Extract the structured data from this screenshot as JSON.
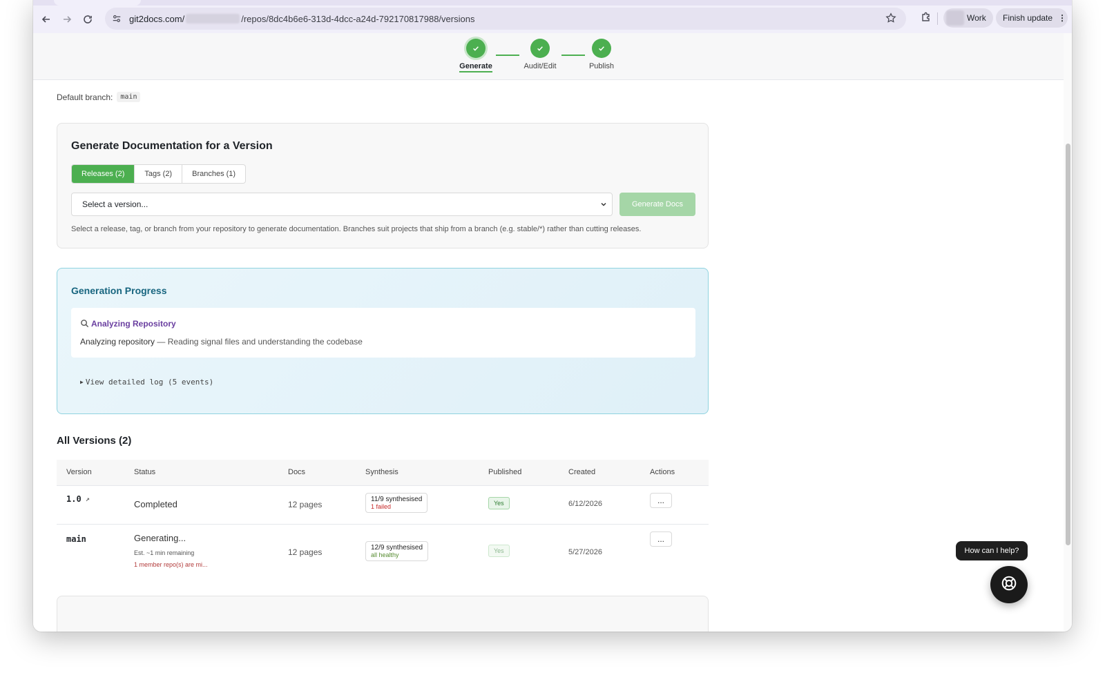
{
  "browser": {
    "url_host": "git2docs.com/",
    "url_path": "/repos/8dc4b6e6-313d-4dcc-a24d-792170817988/versions",
    "profile_label": "Work",
    "update_label": "Finish update",
    "icons": [
      "back-icon",
      "forward-icon",
      "reload-icon",
      "site-settings-icon",
      "star-icon",
      "extensions-icon",
      "more-vert-icon"
    ]
  },
  "stepper": {
    "steps": [
      {
        "label": "Generate",
        "active": true
      },
      {
        "label": "Audit/Edit",
        "active": false
      },
      {
        "label": "Publish",
        "active": false
      }
    ],
    "accent": "#4caf50"
  },
  "repo": {
    "default_branch_label": "Default branch:",
    "default_branch": "main"
  },
  "generate": {
    "title": "Generate Documentation for a Version",
    "tabs": [
      "Releases (2)",
      "Tags (2)",
      "Branches (1)"
    ],
    "active_tab": 0,
    "select_value": "Select a version...",
    "button": "Generate Docs",
    "help": "Select a release, tag, or branch from your repository to generate documentation. Branches suit projects that ship from a branch (e.g. stable/*) rather than cutting releases."
  },
  "progress": {
    "title": "Generation Progress",
    "stage": "Analyzing Repository",
    "desc_strong": "Analyzing repository",
    "desc_rest": " — Reading signal files and understanding the codebase",
    "log_toggle": "View detailed log (5 events)"
  },
  "versions": {
    "title": "All Versions (2)",
    "columns": [
      "Version",
      "Status",
      "Docs",
      "Synthesis",
      "Published",
      "Created",
      "Actions"
    ],
    "rows": [
      {
        "version": "1.0",
        "status": "Completed",
        "docs": "12 pages",
        "synthesis": "11/9 synthesised",
        "synthesis_sub": "1 failed",
        "published": "Yes",
        "created": "6/12/2026",
        "actions": "..."
      },
      {
        "version": "main",
        "status": "Generating...",
        "status_sub": "Est. ~1 min remaining",
        "status_warn": "1 member repo(s) are mi...",
        "docs": "12 pages",
        "synthesis": "12/9 synthesised",
        "synthesis_sub": "all healthy",
        "published": "Yes",
        "created": "5/27/2026",
        "actions": "..."
      }
    ]
  },
  "help": {
    "tooltip": "How can I help?"
  }
}
